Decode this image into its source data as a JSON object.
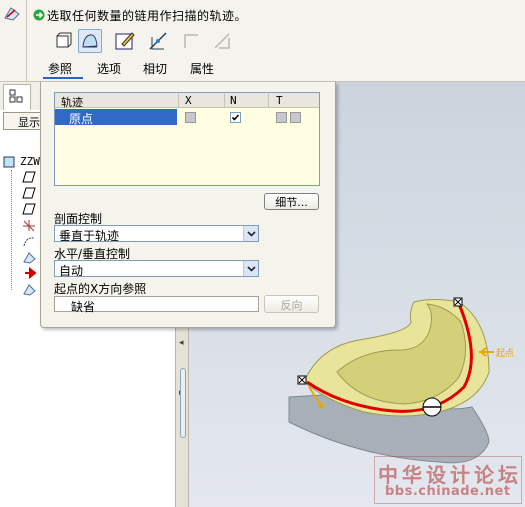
{
  "prompt": "选取任何数量的链用作扫描的轨迹。",
  "dashboard": {
    "tools": [
      "sweep-solid-icon",
      "sweep-surface-icon",
      "sketch-icon",
      "parallel-section-icon",
      "remove-material-icon",
      "thicken-icon"
    ],
    "tabs": [
      "参照",
      "选项",
      "相切",
      "属性"
    ]
  },
  "tree": {
    "show_label": "显示",
    "root_label": "ZZW"
  },
  "panel": {
    "table": {
      "headers": [
        "轨迹",
        "X",
        "N",
        "T"
      ],
      "rows": [
        {
          "label": "原点",
          "x": false,
          "n": true,
          "t": [
            false,
            false
          ]
        }
      ]
    },
    "details_label": "细节...",
    "section_control_label": "剖面控制",
    "section_control_value": "垂直于轨迹",
    "hv_control_label": "水平/垂直控制",
    "hv_control_value": "自动",
    "x_ref_label": "起点的X方向参照",
    "x_ref_value": "缺省",
    "flip_label": "反向"
  },
  "graphics": {
    "model_color": "#e8e49a",
    "trajectory_color": "#e00000"
  },
  "watermark": {
    "line1": "中华设计论坛",
    "line2": "bbs.chinade.net"
  }
}
